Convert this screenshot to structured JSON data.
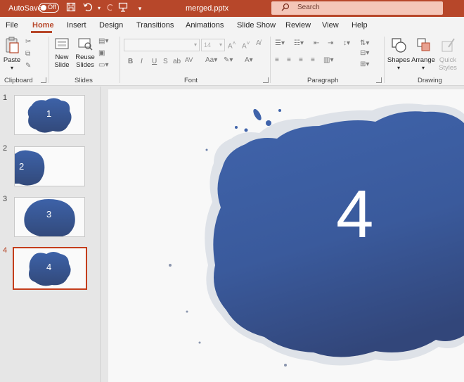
{
  "titlebar": {
    "autosave_label": "AutoSave",
    "autosave_state": "Off",
    "filename": "merged.pptx",
    "search_placeholder": "Search",
    "icons": [
      "save-icon",
      "undo-icon",
      "redo-icon",
      "presenter-icon",
      "customize-qat-icon",
      "search-icon"
    ],
    "bg_color": "#b7472a"
  },
  "tabs": [
    {
      "label": "File"
    },
    {
      "label": "Home",
      "active": true
    },
    {
      "label": "Insert"
    },
    {
      "label": "Design"
    },
    {
      "label": "Transitions"
    },
    {
      "label": "Animations"
    },
    {
      "label": "Slide Show"
    },
    {
      "label": "Review"
    },
    {
      "label": "View"
    },
    {
      "label": "Help"
    }
  ],
  "ribbon": {
    "clipboard": {
      "label": "Clipboard",
      "paste": "Paste"
    },
    "slides": {
      "label": "Slides",
      "new_slide_1": "New",
      "new_slide_2": "Slide",
      "reuse_1": "Reuse",
      "reuse_2": "Slides"
    },
    "font": {
      "label": "Font",
      "font_size": "14",
      "bold": "B",
      "italic": "I",
      "underline": "U",
      "strike": "S",
      "av": "AV"
    },
    "paragraph": {
      "label": "Paragraph"
    },
    "drawing": {
      "label": "Drawing",
      "shapes": "Shapes",
      "arrange": "Arrange",
      "quick_styles_1": "Quick",
      "quick_styles_2": "Styles"
    }
  },
  "slides": [
    {
      "number": "1",
      "label": "1"
    },
    {
      "number": "2",
      "label": "2"
    },
    {
      "number": "3",
      "label": "3"
    },
    {
      "number": "4",
      "label": "4",
      "selected": true
    }
  ],
  "main_slide": {
    "label": "4",
    "accent": "#3a5a9c"
  }
}
